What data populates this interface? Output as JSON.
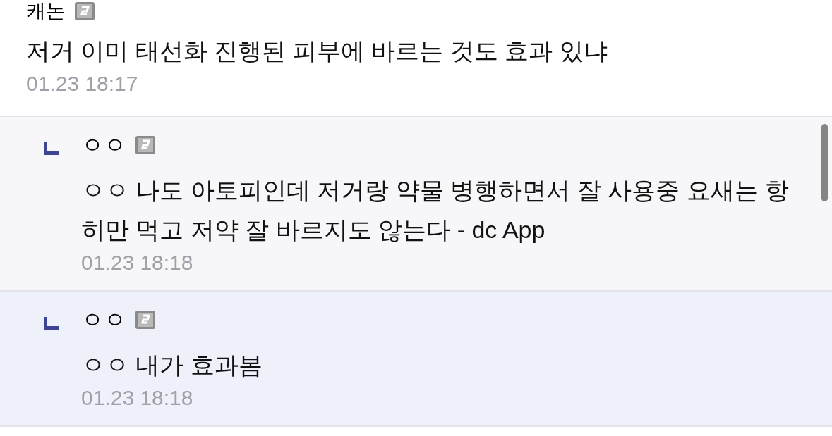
{
  "comment": {
    "author": "캐논",
    "text": "저거 이미 태선화 진행된 피부에 바르는 것도 효과 있냐",
    "time": "01.23 18:17"
  },
  "replies": [
    {
      "author": "ㅇㅇ",
      "text": "ㅇㅇ 나도 아토피인데 저거랑 약물 병행하면서 잘 사용중 요새는 항히만 먹고 저약 잘 바르지도 않는다 - dc App",
      "time": "01.23 18:18",
      "color": "#f7f7f9"
    },
    {
      "author": "ㅇㅇ",
      "text": "ㅇㅇ 내가 효과봄",
      "time": "01.23 18:18",
      "color": "#eef0fa"
    }
  ]
}
